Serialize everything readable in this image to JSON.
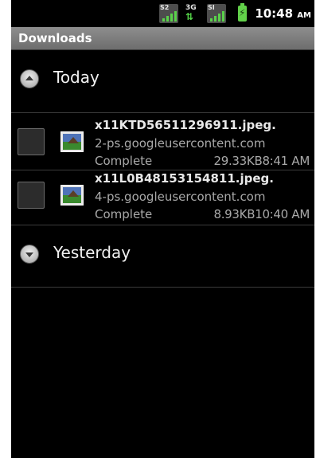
{
  "status_bar": {
    "signal_1_tag": "S2",
    "network_tag": "3G",
    "network_arrows": "⇅",
    "signal_2_tag": "SI",
    "time": "10:48",
    "ampm": "AM"
  },
  "title_bar": {
    "title": "Downloads"
  },
  "groups": [
    {
      "label": "Today",
      "items": [
        {
          "filename": "x11KTD56511296911.jpeg.",
          "host": "2-ps.googleusercontent.com",
          "status": "Complete",
          "size_time": "29.33KB8:41 AM"
        },
        {
          "filename": "x11L0B48153154811.jpeg.",
          "host": "4-ps.googleusercontent.com",
          "status": "Complete",
          "size_time": "8.93KB10:40 AM"
        }
      ]
    },
    {
      "label": "Yesterday",
      "items": []
    }
  ],
  "colors": {
    "background": "#000000",
    "title_bar": "#7d7d7d",
    "signal_green": "#5ad24a",
    "battery_green": "#62d14a"
  }
}
